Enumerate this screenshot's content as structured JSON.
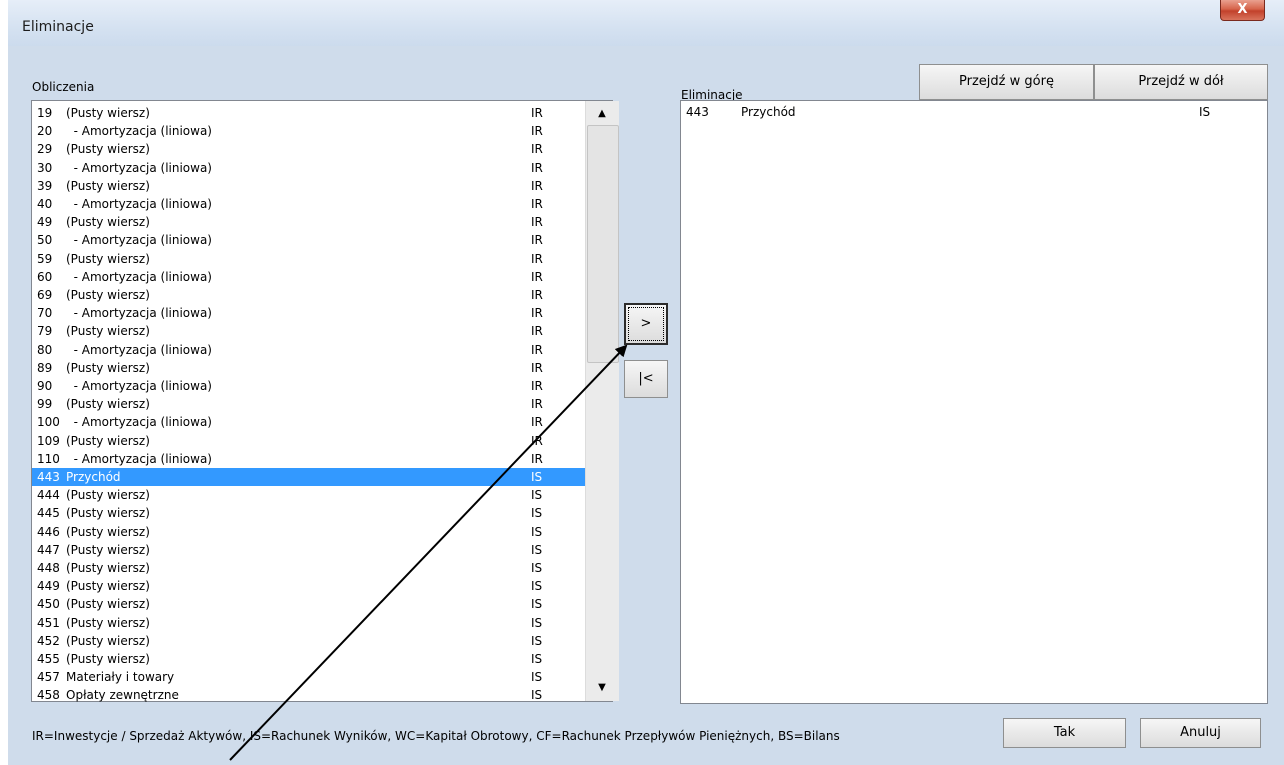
{
  "window": {
    "title": "Eliminacje",
    "close_glyph": "X"
  },
  "left": {
    "label": "Obliczenia",
    "rows": [
      {
        "num": "19",
        "name": "(Pusty wiersz)",
        "tag": "IR"
      },
      {
        "num": "20",
        "name": "  - Amortyzacja (liniowa)",
        "tag": "IR"
      },
      {
        "num": "29",
        "name": "(Pusty wiersz)",
        "tag": "IR"
      },
      {
        "num": "30",
        "name": "  - Amortyzacja (liniowa)",
        "tag": "IR"
      },
      {
        "num": "39",
        "name": "(Pusty wiersz)",
        "tag": "IR"
      },
      {
        "num": "40",
        "name": "  - Amortyzacja (liniowa)",
        "tag": "IR"
      },
      {
        "num": "49",
        "name": "(Pusty wiersz)",
        "tag": "IR"
      },
      {
        "num": "50",
        "name": "  - Amortyzacja (liniowa)",
        "tag": "IR"
      },
      {
        "num": "59",
        "name": "(Pusty wiersz)",
        "tag": "IR"
      },
      {
        "num": "60",
        "name": "  - Amortyzacja (liniowa)",
        "tag": "IR"
      },
      {
        "num": "69",
        "name": "(Pusty wiersz)",
        "tag": "IR"
      },
      {
        "num": "70",
        "name": "  - Amortyzacja (liniowa)",
        "tag": "IR"
      },
      {
        "num": "79",
        "name": "(Pusty wiersz)",
        "tag": "IR"
      },
      {
        "num": "80",
        "name": "  - Amortyzacja (liniowa)",
        "tag": "IR"
      },
      {
        "num": "89",
        "name": "(Pusty wiersz)",
        "tag": "IR"
      },
      {
        "num": "90",
        "name": "  - Amortyzacja (liniowa)",
        "tag": "IR"
      },
      {
        "num": "99",
        "name": "(Pusty wiersz)",
        "tag": "IR"
      },
      {
        "num": "100",
        "name": "  - Amortyzacja (liniowa)",
        "tag": "IR"
      },
      {
        "num": "109",
        "name": "(Pusty wiersz)",
        "tag": "IR"
      },
      {
        "num": "110",
        "name": "  - Amortyzacja (liniowa)",
        "tag": "IR"
      },
      {
        "num": "443",
        "name": "Przychód",
        "tag": "IS",
        "selected": true
      },
      {
        "num": "444",
        "name": "(Pusty wiersz)",
        "tag": "IS"
      },
      {
        "num": "445",
        "name": "(Pusty wiersz)",
        "tag": "IS"
      },
      {
        "num": "446",
        "name": "(Pusty wiersz)",
        "tag": "IS"
      },
      {
        "num": "447",
        "name": "(Pusty wiersz)",
        "tag": "IS"
      },
      {
        "num": "448",
        "name": "(Pusty wiersz)",
        "tag": "IS"
      },
      {
        "num": "449",
        "name": "(Pusty wiersz)",
        "tag": "IS"
      },
      {
        "num": "450",
        "name": "(Pusty wiersz)",
        "tag": "IS"
      },
      {
        "num": "451",
        "name": "(Pusty wiersz)",
        "tag": "IS"
      },
      {
        "num": "452",
        "name": "(Pusty wiersz)",
        "tag": "IS"
      },
      {
        "num": "455",
        "name": "(Pusty wiersz)",
        "tag": "IS"
      },
      {
        "num": "457",
        "name": "Materiały i towary",
        "tag": "IS"
      },
      {
        "num": "458",
        "name": "Opłaty zewnętrzne",
        "tag": "IS"
      }
    ],
    "scroll_up_glyph": "▲",
    "scroll_down_glyph": "▼"
  },
  "middle": {
    "add_label": ">",
    "remove_label": "|<"
  },
  "right": {
    "label": "Eliminacje",
    "move_up_label": "Przejdź w górę",
    "move_down_label": "Przejdź w dół",
    "rows": [
      {
        "num": "443",
        "name": "Przychód",
        "tag": "IS"
      }
    ]
  },
  "footer": {
    "legend": "IR=Inwestycje / Sprzedaż Aktywów, IS=Rachunek Wyników, WC=Kapitał Obrotowy, CF=Rachunek Przepływów Pieniężnych, BS=Bilans",
    "ok_label": "Tak",
    "cancel_label": "Anuluj"
  },
  "colors": {
    "selection": "#3399ff",
    "title_bg": "#d5e2f1",
    "client_bg": "#f0f0f0",
    "close_red": "#c2412b"
  }
}
